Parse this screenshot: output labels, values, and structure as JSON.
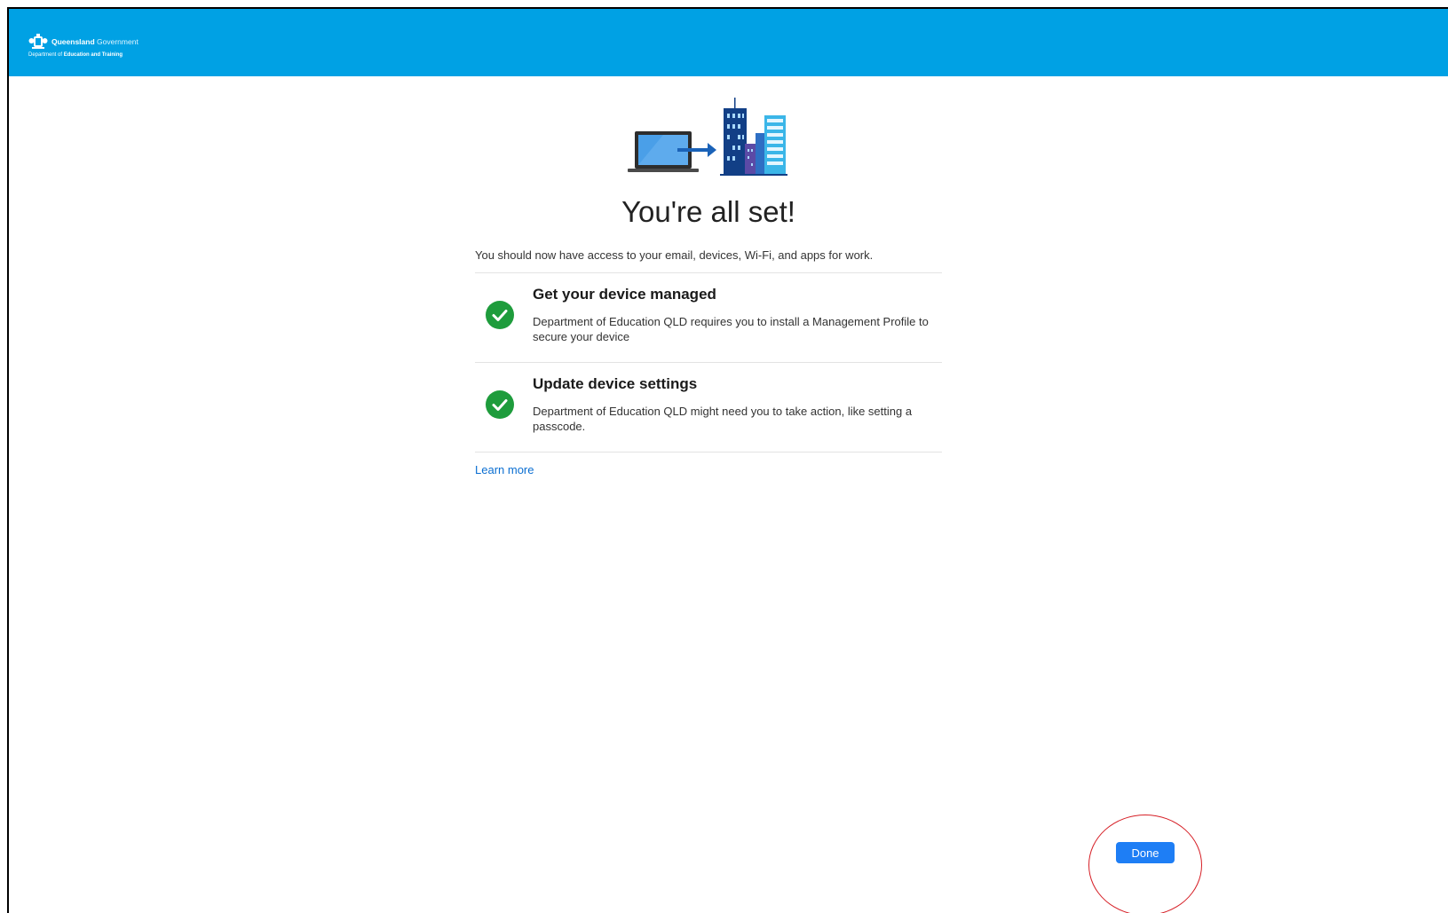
{
  "header": {
    "logo_name_bold": "Queensland",
    "logo_name_light": "Government",
    "logo_dept_prefix": "Department of ",
    "logo_dept_bold": "Education and Training",
    "background_color": "#00a1e4"
  },
  "main": {
    "title": "You're all set!",
    "intro": "You should now have access to your email, devices, Wi-Fi, and apps for work.",
    "steps": [
      {
        "title": "Get your device managed",
        "description": "Department of Education QLD requires you to install a Management Profile to secure your device",
        "status": "complete",
        "icon": "check-circle-icon"
      },
      {
        "title": "Update device settings",
        "description": "Department of Education QLD might need you to take action, like setting a passcode.",
        "status": "complete",
        "icon": "check-circle-icon"
      }
    ],
    "learn_more": "Learn more",
    "success_color": "#1e9c3c",
    "link_color": "#0a6ed1"
  },
  "footer": {
    "done_label": "Done",
    "button_color": "#1e7ef5",
    "annotation_color": "#d61f26"
  }
}
